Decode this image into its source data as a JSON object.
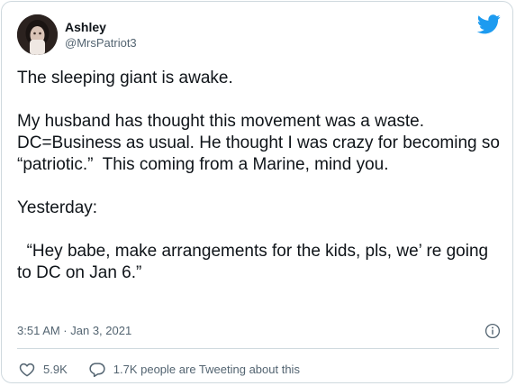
{
  "author": {
    "display_name": "Ashley",
    "handle": "@MrsPatriot3"
  },
  "tweet": {
    "paragraphs": [
      "The sleeping giant is awake.",
      "My husband has thought this movement was a waste. DC=Business as usual. He thought I was crazy for becoming so “patriotic.”  This coming from a Marine, mind you.",
      "Yesterday:",
      "  “Hey babe, make arrangements for the kids, pls, we’ re going to DC on Jan 6.”"
    ],
    "timestamp": "3:51 AM · Jan 3, 2021"
  },
  "actions": {
    "like_count": "5.9K",
    "reply_label": "1.7K people are Tweeting about this"
  },
  "icons": {
    "brand": "bird-logo-icon",
    "info": "info-icon",
    "like": "heart-icon",
    "reply": "speech-bubble-icon"
  },
  "colors": {
    "brand": "#1d9bf0",
    "text": "#0f1419",
    "muted": "#536471",
    "border": "#cfd9de"
  }
}
